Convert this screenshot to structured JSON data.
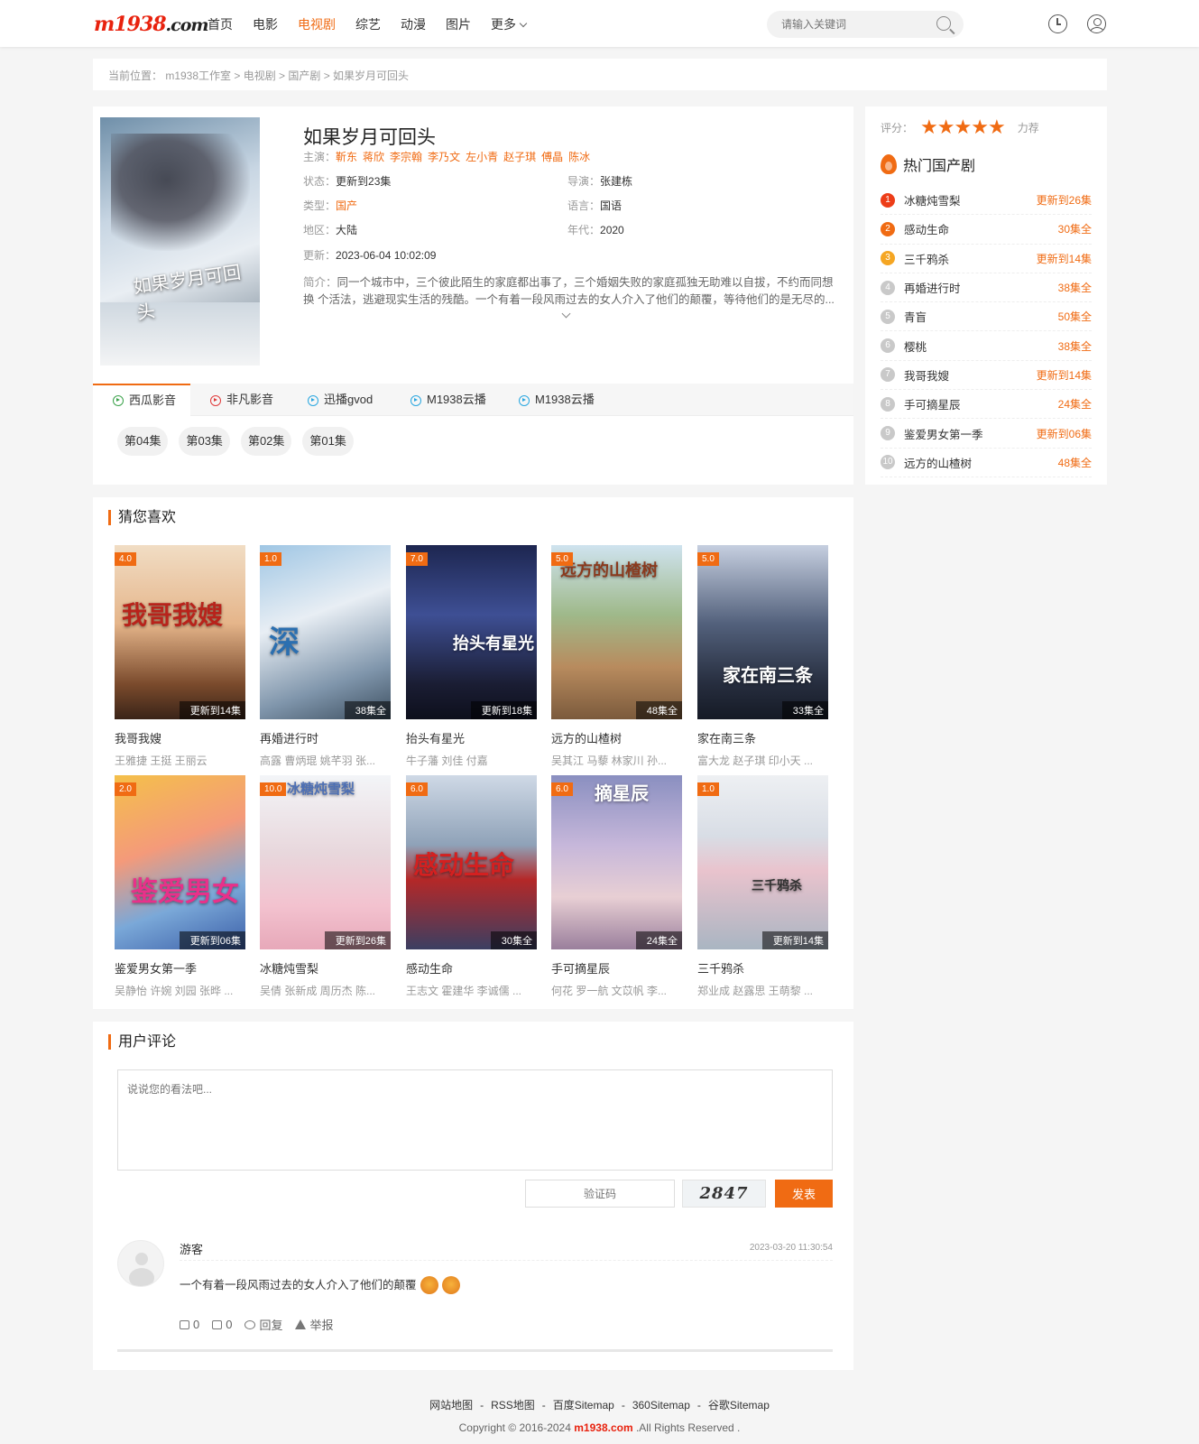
{
  "header": {
    "logo_main": "m1938",
    "logo_suffix": ".com",
    "nav": [
      {
        "label": "首页",
        "active": false
      },
      {
        "label": "电影",
        "active": false
      },
      {
        "label": "电视剧",
        "active": true
      },
      {
        "label": "综艺",
        "active": false
      },
      {
        "label": "动漫",
        "active": false
      },
      {
        "label": "图片",
        "active": false
      },
      {
        "label": "更多",
        "active": false
      }
    ],
    "search_placeholder": "请输入关键词",
    "icons": [
      "search-icon",
      "clock-icon",
      "user-icon"
    ]
  },
  "breadcrumb": "当前位置： m1938工作室 > 电视剧 > 国产剧 > 如果岁月可回头",
  "detail": {
    "poster_lettering": "如果岁月可回头",
    "title": "如果岁月可回头",
    "cast_label": "主演：",
    "cast": [
      "靳东",
      "蒋欣",
      "李宗翰",
      "李乃文",
      "左小青",
      "赵子琪",
      "傅晶",
      "陈冰"
    ],
    "status_label": "状态：",
    "status": "更新到23集",
    "director_label": "导演：",
    "director": "张建栋",
    "type_label": "类型：",
    "type": "国产",
    "lang_label": "语言：",
    "lang": "国语",
    "area_label": "地区：",
    "area": "大陆",
    "year_label": "年代：",
    "year": "2020",
    "update_label": "更新：",
    "update": "2023-06-04 10:02:09",
    "intro_label": "简介：",
    "intro": "同一个城市中，三个彼此陌生的家庭都出事了，三个婚姻失败的家庭孤独无助难以自拔，不约而同想换 个活法，逃避现实生活的残酷。一个有着一段风雨过去的女人介入了他们的颠覆，等待他们的是无尽的..."
  },
  "play_tabs": [
    {
      "label": "西瓜影音",
      "color": "#3aa24a"
    },
    {
      "label": "非凡影音",
      "color": "#e03b3b"
    },
    {
      "label": "迅播gvod",
      "color": "#2aa7e0"
    },
    {
      "label": "M1938云播",
      "color": "#2aa7e0"
    },
    {
      "label": "M1938云播",
      "color": "#2aa7e0"
    }
  ],
  "episodes": [
    "第04集",
    "第03集",
    "第02集",
    "第01集"
  ],
  "recommend": {
    "title": "猜您喜欢",
    "items": [
      {
        "name": "我哥我嫂",
        "actors": "王雅捷 王挺 王丽云",
        "score": "4.0",
        "remark": "更新到14集",
        "lettering": "我哥我嫂",
        "bg": "linear-gradient(180deg,#f1ddc4 0%,#e5b58a 45%,#7a4a2c 80%,#3a2418 100%)"
      },
      {
        "name": "再婚进行时",
        "actors": "高露 曹炳琨 姚芊羽 张...",
        "score": "1.0",
        "remark": "38集全",
        "lettering": "深",
        "bg": "linear-gradient(160deg,#9fc6e4 0%,#e8eef4 40%,#7f95ab 75%,#3d4f60 100%)"
      },
      {
        "name": "抬头有星光",
        "actors": "牛子藩 刘佳 付嘉",
        "score": "7.0",
        "remark": "更新到18集",
        "lettering": "抬头有星光",
        "bg": "linear-gradient(180deg,#1d2650 0%,#3e4f94 40%,#1a1d33 80%,#0d0f1c 100%)"
      },
      {
        "name": "远方的山楂树",
        "actors": "吴其江 马藜 林家川 孙...",
        "score": "5.0",
        "remark": "48集全",
        "lettering": "远方的山楂树",
        "bg": "linear-gradient(180deg,#cfe3ef 0%,#9fb98a 40%,#b88b5e 70%,#7b5a3c 100%)"
      },
      {
        "name": "家在南三条",
        "actors": "富大龙 赵子琪 印小天 ...",
        "score": "5.0",
        "remark": "33集全",
        "lettering": "家在南三条",
        "bg": "linear-gradient(180deg,#c6cfe0 0%,#53617c 45%,#262d3e 80%,#151a25 100%)"
      },
      {
        "name": "鉴爱男女第一季",
        "actors": "吴静怡 许婉 刘园 张晔 ...",
        "score": "2.0",
        "remark": "更新到06集",
        "lettering": "鉴爱男女",
        "bg": "linear-gradient(160deg,#f4c04a 0%,#f49a7a 40%,#7aa8d8 70%,#3c5fa8 100%)"
      },
      {
        "name": "冰糖炖雪梨",
        "actors": "吴倩 张新成 周历杰 陈...",
        "score": "10.0",
        "remark": "更新到26集",
        "lettering": "冰糖炖雪梨",
        "bg": "linear-gradient(180deg,#f3f5f8 0%,#e8d7dc 45%,#f3c2cf 75%,#e7a8b9 100%)"
      },
      {
        "name": "感动生命",
        "actors": "王志文 霍建华 李诚儒 ...",
        "score": "6.0",
        "remark": "30集全",
        "lettering": "感动生命",
        "bg": "linear-gradient(180deg,#cfd9e6 0%,#8fa2b8 40%,#b42828 60%,#3b3f62 100%)"
      },
      {
        "name": "手可摘星辰",
        "actors": "何花 罗一航 文苡帆 李...",
        "score": "6.0",
        "remark": "24集全",
        "lettering": "摘星辰",
        "bg": "linear-gradient(180deg,#8a8fc0 0%,#c6b7da 40%,#e8cfd4 70%,#9a7f9c 100%)"
      },
      {
        "name": "三千鸦杀",
        "actors": "郑业成 赵露思 王萌黎 ...",
        "score": "1.0",
        "remark": "更新到14集",
        "lettering": "三千鸦杀",
        "bg": "linear-gradient(180deg,#eef0f3 0%,#d8dde5 35%,#e9c3cd 55%,#a9b5c2 100%)"
      }
    ]
  },
  "comments": {
    "title": "用户评论",
    "placeholder": "说说您的看法吧...",
    "vcode_placeholder": "验证码",
    "vcode_text": "2847",
    "submit_label": "发表",
    "list": [
      {
        "user": "游客",
        "time": "2023-03-20 11:30:54",
        "text": "一个有着一段风雨过去的女人介入了他们的颠覆",
        "likes": "0",
        "dislikes": "0",
        "reply_label": "回复",
        "report_label": "举报"
      }
    ]
  },
  "sidebar": {
    "rating_label": "评分：",
    "rating_stars": 5,
    "rating_word": "力荐",
    "hot_title": "热门国产剧",
    "hot": [
      {
        "rank": "1",
        "name": "冰糖炖雪梨",
        "tag": "更新到26集"
      },
      {
        "rank": "2",
        "name": "感动生命",
        "tag": "30集全"
      },
      {
        "rank": "3",
        "name": "三千鸦杀",
        "tag": "更新到14集"
      },
      {
        "rank": "4",
        "name": "再婚进行时",
        "tag": "38集全"
      },
      {
        "rank": "5",
        "name": "青盲",
        "tag": "50集全"
      },
      {
        "rank": "6",
        "name": "樱桃",
        "tag": "38集全"
      },
      {
        "rank": "7",
        "name": "我哥我嫂",
        "tag": "更新到14集"
      },
      {
        "rank": "8",
        "name": "手可摘星辰",
        "tag": "24集全"
      },
      {
        "rank": "9",
        "name": "鉴爱男女第一季",
        "tag": "更新到06集"
      },
      {
        "rank": "10",
        "name": "远方的山楂树",
        "tag": "48集全"
      }
    ]
  },
  "footer": {
    "links": [
      "网站地图",
      "RSS地图",
      "百度Sitemap",
      "360Sitemap",
      "谷歌Sitemap"
    ],
    "copy_prefix": "Copyright © 2016-2024",
    "brand": "m1938.com",
    "copy_suffix": ".All Rights Reserved ."
  },
  "colors": {
    "accent": "#f06b13",
    "logo_red": "#e8220e"
  }
}
